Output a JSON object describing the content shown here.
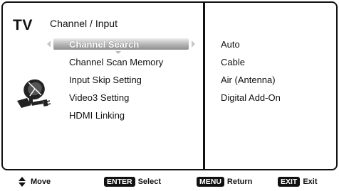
{
  "header": {
    "tv_label": "TV",
    "title": "Channel / Input"
  },
  "menu": {
    "selected_index": 0,
    "items": [
      {
        "label": "Channel Search"
      },
      {
        "label": "Channel Scan Memory"
      },
      {
        "label": "Input Skip Setting"
      },
      {
        "label": "Video3 Setting"
      },
      {
        "label": "HDMI Linking"
      }
    ]
  },
  "options": [
    "Auto",
    "Cable",
    "Air (Antenna)",
    "Digital Add-On"
  ],
  "footer": {
    "move": {
      "label": "Move",
      "icon": "up-down-arrow-icon"
    },
    "select": {
      "key": "ENTER",
      "label": "Select"
    },
    "return": {
      "key": "MENU",
      "label": "Return"
    },
    "exit": {
      "key": "EXIT",
      "label": "Exit"
    }
  },
  "icons": {
    "menu_category": "satellite-dish-icon"
  },
  "colors": {
    "highlight_top": "#ededed",
    "highlight_bottom": "#8e8e8e",
    "text": "#111111",
    "key_bg": "#111111"
  }
}
